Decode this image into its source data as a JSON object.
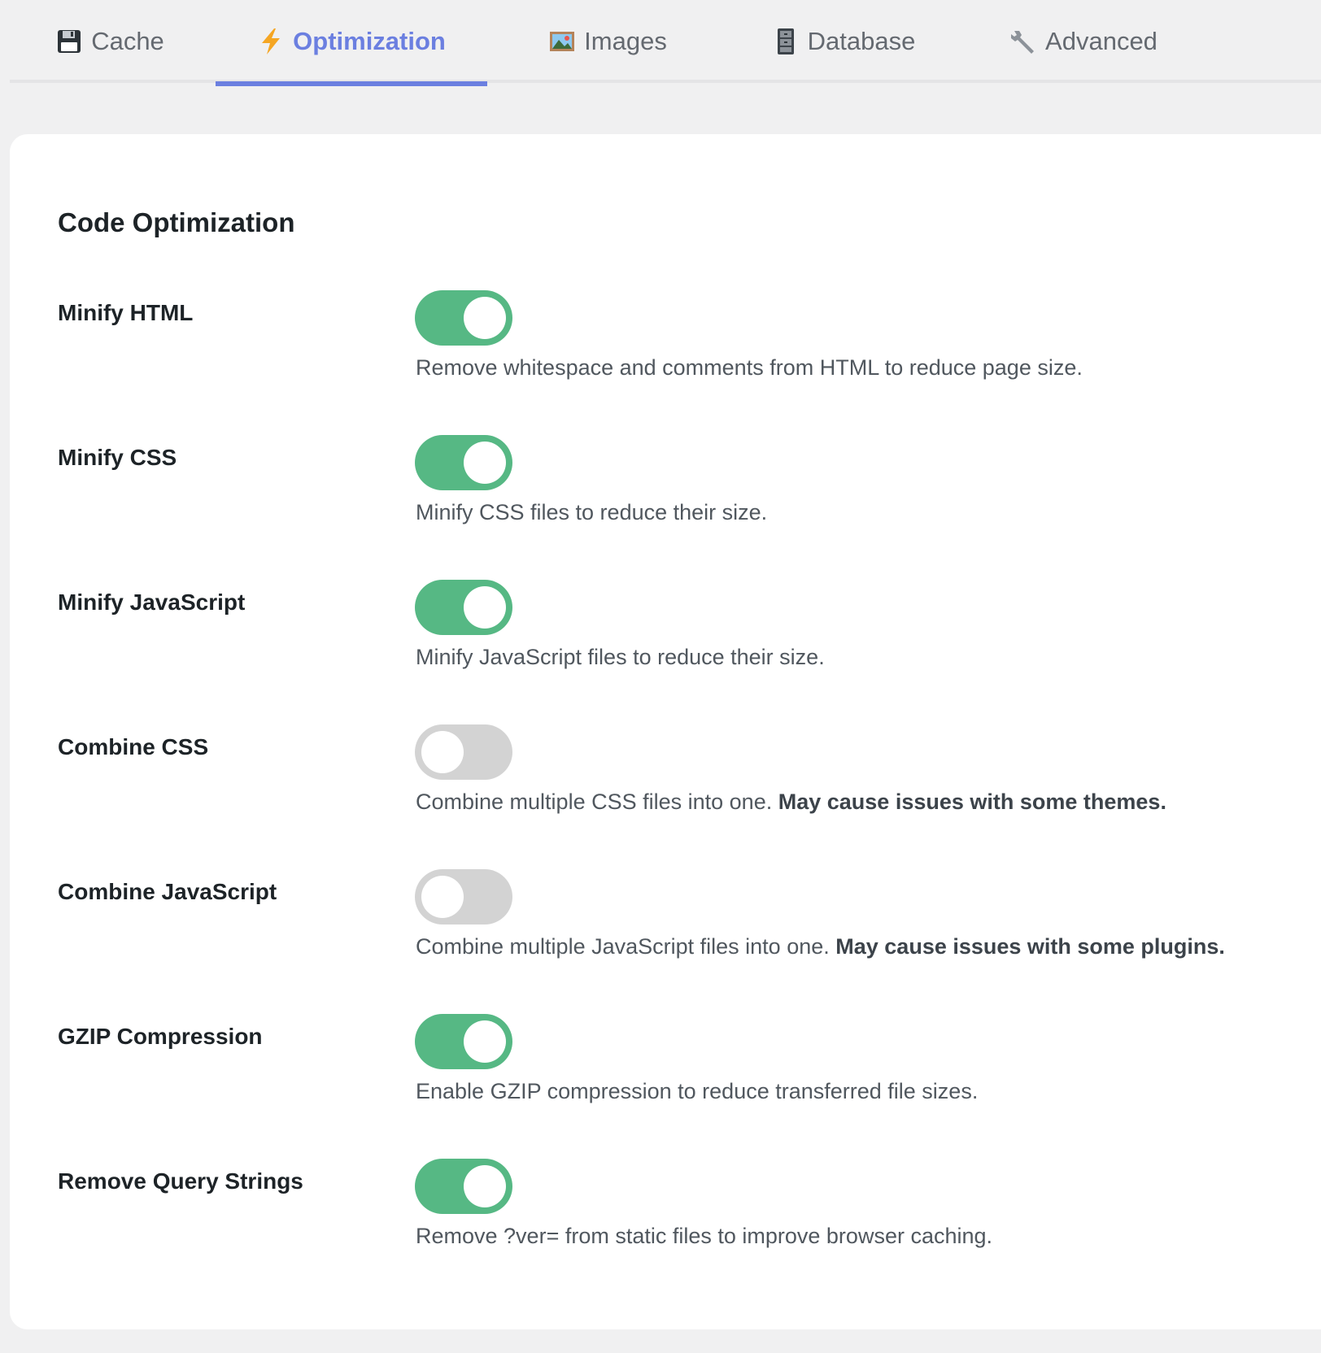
{
  "tabs": [
    {
      "label": "Cache",
      "icon": "floppy-disk-icon"
    },
    {
      "label": "Optimization",
      "icon": "lightning-icon"
    },
    {
      "label": "Images",
      "icon": "framed-picture-icon"
    },
    {
      "label": "Database",
      "icon": "file-cabinet-icon"
    },
    {
      "label": "Advanced",
      "icon": "wrench-icon"
    }
  ],
  "active_tab": "Optimization",
  "colors": {
    "accent": "#6b7fe0",
    "toggle_on": "#56b884",
    "toggle_off": "#d3d3d3"
  },
  "section": {
    "title": "Code Optimization"
  },
  "settings": [
    {
      "label": "Minify HTML",
      "enabled": true,
      "description": "Remove whitespace and comments from HTML to reduce page size.",
      "warning": ""
    },
    {
      "label": "Minify CSS",
      "enabled": true,
      "description": "Minify CSS files to reduce their size.",
      "warning": ""
    },
    {
      "label": "Minify JavaScript",
      "enabled": true,
      "description": "Minify JavaScript files to reduce their size.",
      "warning": ""
    },
    {
      "label": "Combine CSS",
      "enabled": false,
      "description": "Combine multiple CSS files into one.",
      "warning": "May cause issues with some themes."
    },
    {
      "label": "Combine JavaScript",
      "enabled": false,
      "description": "Combine multiple JavaScript files into one.",
      "warning": "May cause issues with some plugins."
    },
    {
      "label": "GZIP Compression",
      "enabled": true,
      "description": "Enable GZIP compression to reduce transferred file sizes.",
      "warning": ""
    },
    {
      "label": "Remove Query Strings",
      "enabled": true,
      "description": "Remove ?ver= from static files to improve browser caching.",
      "warning": ""
    }
  ]
}
